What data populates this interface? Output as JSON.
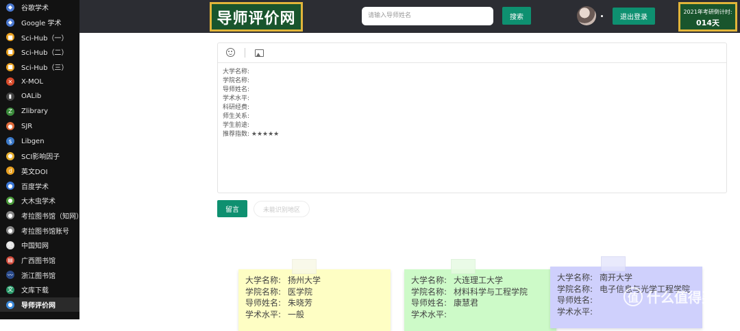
{
  "sidebar": {
    "items": [
      {
        "label": "谷歌学术",
        "icon": "scholar-icon",
        "color": "#4a78d0",
        "glyph": "◆"
      },
      {
        "label": "Google 学术",
        "icon": "scholar-icon",
        "color": "#4a78d0",
        "glyph": "◆"
      },
      {
        "label": "Sci-Hub（一）",
        "icon": "scihub-icon",
        "color": "#e8a020",
        "glyph": "■"
      },
      {
        "label": "Sci-Hub（二）",
        "icon": "scihub-icon",
        "color": "#e8a020",
        "glyph": "■"
      },
      {
        "label": "Sci-Hub（三）",
        "icon": "scihub-icon",
        "color": "#e8a020",
        "glyph": "■"
      },
      {
        "label": "X-MOL",
        "icon": "xmol-icon",
        "color": "#d84a2a",
        "glyph": "✕"
      },
      {
        "label": "OALib",
        "icon": "oalib-icon",
        "color": "#444444",
        "glyph": "▮"
      },
      {
        "label": "Zlibrary",
        "icon": "zlibrary-icon",
        "color": "#3a8a3a",
        "glyph": "Z"
      },
      {
        "label": "SJR",
        "icon": "sjr-icon",
        "color": "#e06a3a",
        "glyph": "●"
      },
      {
        "label": "Libgen",
        "icon": "libgen-icon",
        "color": "#3a78c8",
        "glyph": "$"
      },
      {
        "label": "SCI影响因子",
        "icon": "impact-factor-icon",
        "color": "#e8b030",
        "glyph": "●"
      },
      {
        "label": "英文DOI",
        "icon": "doi-icon",
        "color": "#e8a020",
        "glyph": "d"
      },
      {
        "label": "百度学术",
        "icon": "baidu-scholar-icon",
        "color": "#3a78d8",
        "glyph": "●"
      },
      {
        "label": "大木虫学术",
        "icon": "damuchong-icon",
        "color": "#4a9a3a",
        "glyph": "●"
      },
      {
        "label": "考拉图书馆（知网）",
        "icon": "koala-library-icon",
        "color": "#888888",
        "glyph": "●"
      },
      {
        "label": "考拉图书馆账号",
        "icon": "koala-account-icon",
        "color": "#888888",
        "glyph": "●"
      },
      {
        "label": "中国知网",
        "icon": "cnki-icon",
        "color": "#dddddd",
        "glyph": "知"
      },
      {
        "label": "广西图书馆",
        "icon": "guangxi-library-icon",
        "color": "#d04a3a",
        "glyph": "▤"
      },
      {
        "label": "浙江图书馆",
        "icon": "zhejiang-library-icon",
        "color": "#2a4a8a",
        "glyph": "〰"
      },
      {
        "label": "文库下载",
        "icon": "library-download-icon",
        "color": "#2a9a6a",
        "glyph": "文"
      },
      {
        "label": "导师评价网",
        "icon": "tutor-review-icon",
        "color": "#3a88d8",
        "glyph": "●",
        "active": true
      }
    ]
  },
  "header": {
    "logo": "导师评价网",
    "search_placeholder": "请输入导师姓名",
    "search_button": "搜索",
    "logout_button": "退出登录",
    "countdown_label": "2021年考研倒计时:",
    "countdown_value": "014天"
  },
  "editor": {
    "toolbar": [
      "emoji-icon",
      "image-icon"
    ],
    "lines": [
      "大学名称:",
      "学院名称:",
      "导师姓名:",
      "学术水平:",
      "科研经费:",
      "师生关系:",
      "学生前途:",
      "推荐指数: ★★★★★"
    ]
  },
  "actions": {
    "submit": "留言",
    "unread": "未能识别地区"
  },
  "cards": [
    {
      "color": "#fefec4",
      "rows": [
        {
          "k": "大学名称:",
          "v": "扬州大学"
        },
        {
          "k": "学院名称:",
          "v": "医学院"
        },
        {
          "k": "导师姓名:",
          "v": "朱晓芳"
        },
        {
          "k": "学术水平:",
          "v": "一般"
        }
      ]
    },
    {
      "color": "#cdfac8",
      "rows": [
        {
          "k": "大学名称:",
          "v": "大连理工大学"
        },
        {
          "k": "学院名称:",
          "v": "材料科学与工程学院"
        },
        {
          "k": "导师姓名:",
          "v": "康慧君"
        },
        {
          "k": "学术水平:",
          "v": ""
        }
      ]
    },
    {
      "color": "#cfd0fc",
      "rows": [
        {
          "k": "大学名称:",
          "v": "南开大学"
        },
        {
          "k": "学院名称:",
          "v": "电子信息与光学工程学院"
        },
        {
          "k": "导师姓名:",
          "v": ""
        },
        {
          "k": "学术水平:",
          "v": ""
        }
      ]
    }
  ],
  "watermark": "什么值得买"
}
